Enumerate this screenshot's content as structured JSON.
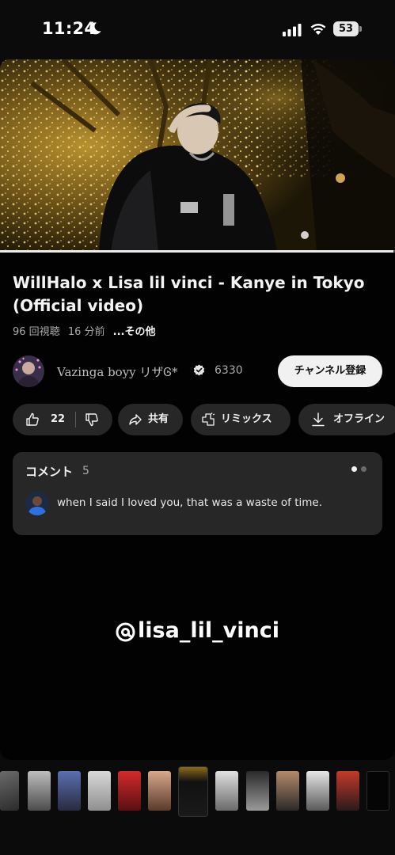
{
  "status_bar": {
    "time": "11:24",
    "battery": "53",
    "icons": [
      "moon-icon",
      "signal-icon",
      "wifi-icon",
      "battery-icon"
    ]
  },
  "video": {
    "title": "WillHalo x Lisa lil vinci - Kanye in Tokyo (Official video)",
    "views": "96 回視聴",
    "time_ago": "16 分前",
    "more": "...その他",
    "progress": 0.995
  },
  "channel": {
    "name": "Vazinga boyy リザᎶ*",
    "subscribers": "6330",
    "subscribe_label": "チャンネル登録",
    "verified_icon": "verified-badge-icon"
  },
  "actions": {
    "like_count": "22",
    "share_label": "共有",
    "remix_label": "リミックス",
    "offline_label": "オフライン"
  },
  "comments": {
    "header": "コメント",
    "count": "5",
    "top_comment": "when I said I loved you, that was a waste of time."
  },
  "overlay": {
    "mention": "lisa_lil_vinci"
  },
  "colors": {
    "background": "#020202",
    "pill": "#272727",
    "subscribe_bg": "#f1f1f1",
    "secondary_text": "#a8a8a8"
  }
}
